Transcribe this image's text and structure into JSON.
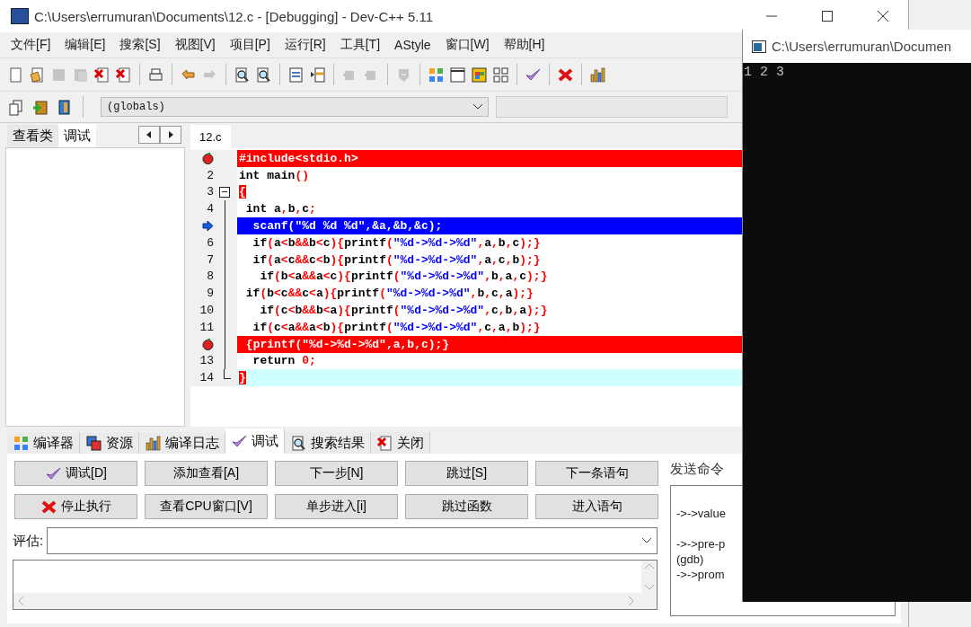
{
  "window": {
    "title": "C:\\Users\\errumuran\\Documents\\12.c - [Debugging] - Dev-C++ 5.11"
  },
  "menu": [
    "文件[F]",
    "编辑[E]",
    "搜索[S]",
    "视图[V]",
    "项目[P]",
    "运行[R]",
    "工具[T]",
    "AStyle",
    "窗口[W]",
    "帮助[H]"
  ],
  "toolbar": [
    {
      "kind": "new",
      "disabled": false
    },
    {
      "kind": "open",
      "disabled": false
    },
    {
      "kind": "save",
      "disabled": true
    },
    {
      "kind": "saveall",
      "disabled": true
    },
    {
      "kind": "close",
      "disabled": false
    },
    {
      "kind": "closeall",
      "disabled": false
    },
    {
      "kind": "sep"
    },
    {
      "kind": "print",
      "disabled": false
    },
    {
      "kind": "sep"
    },
    {
      "kind": "undo",
      "disabled": false
    },
    {
      "kind": "redo",
      "disabled": true
    },
    {
      "kind": "sep"
    },
    {
      "kind": "find",
      "disabled": false
    },
    {
      "kind": "replace",
      "disabled": false
    },
    {
      "kind": "sep"
    },
    {
      "kind": "list",
      "disabled": false
    },
    {
      "kind": "indent",
      "disabled": false
    },
    {
      "kind": "sep"
    },
    {
      "kind": "compile",
      "disabled": true
    },
    {
      "kind": "run",
      "disabled": true
    },
    {
      "kind": "sep"
    },
    {
      "kind": "shield",
      "disabled": true
    },
    {
      "kind": "sep"
    },
    {
      "kind": "grid",
      "disabled": false
    },
    {
      "kind": "window",
      "disabled": false
    },
    {
      "kind": "colors",
      "disabled": false
    },
    {
      "kind": "tiles",
      "disabled": false
    },
    {
      "kind": "sep"
    },
    {
      "kind": "check",
      "disabled": false
    },
    {
      "kind": "sep"
    },
    {
      "kind": "cross",
      "disabled": false
    },
    {
      "kind": "sep"
    },
    {
      "kind": "chart",
      "disabled": false
    }
  ],
  "project_toolbar": [
    {
      "kind": "pages"
    },
    {
      "kind": "add"
    },
    {
      "kind": "book"
    }
  ],
  "scope_combo": {
    "value": "(globals)"
  },
  "left_tabs": [
    {
      "label": "查看类",
      "selected": false
    },
    {
      "label": "调试",
      "selected": true
    }
  ],
  "editor_tabs": [
    {
      "label": "12.c",
      "selected": true
    }
  ],
  "code": [
    {
      "text": "#include<stdio.h>",
      "breakpoint": true,
      "current": false,
      "brace_match": false
    },
    {
      "number": "2",
      "text": "int main()",
      "breakpoint": false,
      "current": false,
      "caret": false,
      "brace_match": false
    },
    {
      "number": "3",
      "text": "{",
      "breakpoint": false,
      "current": false,
      "caret": false,
      "brace_match": true,
      "expanded": true,
      "children": [
        {
          "number": "4",
          "text": " int a,b,c;",
          "breakpoint": false,
          "current": false,
          "caret": false,
          "brace_match": false
        },
        {
          "text": "  scanf(\"%d %d %d\",&a,&b,&c);",
          "breakpoint": false,
          "current": true,
          "brace_match": false
        },
        {
          "number": "6",
          "text": "  if(a<b&&b<c){printf(\"%d->%d->%d\",a,b,c);}",
          "breakpoint": false,
          "current": false,
          "caret": false,
          "brace_match": false
        },
        {
          "number": "7",
          "text": "  if(a<c&&c<b){printf(\"%d->%d->%d\",a,c,b);}",
          "breakpoint": false,
          "current": false,
          "caret": false,
          "brace_match": false
        },
        {
          "number": "8",
          "text": "   if(b<a&&a<c){printf(\"%d->%d->%d\",b,a,c);}",
          "breakpoint": false,
          "current": false,
          "caret": false,
          "brace_match": false
        },
        {
          "number": "9",
          "text": " if(b<c&&c<a){printf(\"%d->%d->%d\",b,c,a);}",
          "breakpoint": false,
          "current": false,
          "caret": false,
          "brace_match": false
        },
        {
          "number": "10",
          "text": "   if(c<b&&b<a){printf(\"%d->%d->%d\",c,b,a);}",
          "breakpoint": false,
          "current": false,
          "caret": false,
          "brace_match": false
        },
        {
          "number": "11",
          "text": "  if(c<a&&a<b){printf(\"%d->%d->%d\",c,a,b);}",
          "breakpoint": false,
          "current": false,
          "caret": false,
          "brace_match": false
        },
        {
          "text": " {printf(\"%d->%d->%d\",a,b,c);}",
          "breakpoint": true,
          "current": false,
          "brace_match": false
        },
        {
          "number": "13",
          "text": "  return 0;",
          "breakpoint": false,
          "current": false,
          "caret": false,
          "brace_match": false
        },
        {
          "number": "14",
          "text": "}",
          "breakpoint": false,
          "current": false,
          "caret": true,
          "brace_match": true
        }
      ]
    }
  ],
  "bottom_tabs": [
    {
      "label": "编译器",
      "kind": "grid",
      "selected": false
    },
    {
      "label": "资源",
      "kind": "resources",
      "selected": false
    },
    {
      "label": "编译日志",
      "kind": "chart",
      "selected": false
    },
    {
      "label": "调试",
      "kind": "check",
      "selected": true
    },
    {
      "label": "搜索结果",
      "kind": "find",
      "selected": false
    },
    {
      "label": "关闭",
      "kind": "close",
      "selected": false
    }
  ],
  "debug_buttons": [
    {
      "label": "调试[D]",
      "kind": "check"
    },
    {
      "label": "添加查看[A]"
    },
    {
      "label": "下一步[N]"
    },
    {
      "label": "跳过[S]"
    },
    {
      "label": "下一条语句"
    },
    {
      "label": "停止执行",
      "kind": "cross"
    },
    {
      "label": "查看CPU窗口[V]"
    },
    {
      "label": "单步进入[i]"
    },
    {
      "label": "跳过函数"
    },
    {
      "label": "进入语句"
    }
  ],
  "evaluate": {
    "label": "评估:"
  },
  "send_command": {
    "label": "发送命令",
    "output": [
      "->->value",
      "->->pre-p",
      "(gdb)",
      "->->prom"
    ]
  },
  "console": {
    "title": "C:\\Users\\errumuran\\Documen",
    "output": "1 2 3"
  }
}
